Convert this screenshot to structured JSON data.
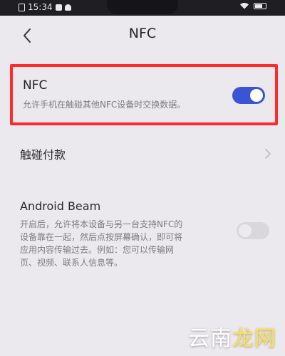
{
  "status_bar": {
    "time": "15:34"
  },
  "header": {
    "title": "NFC"
  },
  "nfc": {
    "title": "NFC",
    "description": "允许手机在触碰其他NFC设备时交换数据。",
    "toggle_on": true,
    "accent_color": "#3a54d6",
    "highlight_color": "#ff2b2b"
  },
  "touch_payment": {
    "title": "触碰付款"
  },
  "android_beam": {
    "title": "Android Beam",
    "description_lines": [
      "开启后，允许将本设备与另一台支持NFC的",
      "设备靠在一起，然后点按屏幕确认，即可将",
      "应用内容传输过去。例如：您可以传输网",
      "页、视频、联系人信息等。"
    ],
    "toggle_on": false
  },
  "watermark": {
    "part1": "云南",
    "part2": "龙网"
  }
}
